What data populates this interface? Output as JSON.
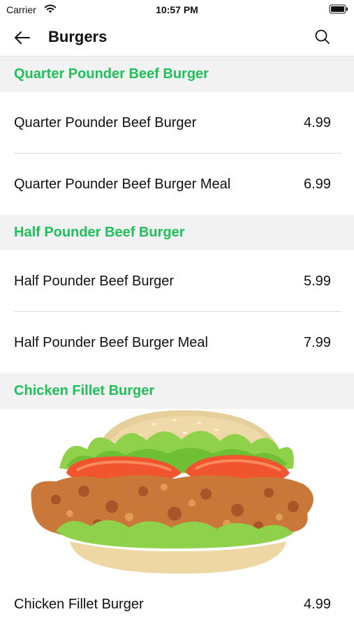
{
  "status_bar": {
    "carrier": "Carrier",
    "time": "10:57 PM"
  },
  "nav": {
    "title": "Burgers",
    "back_icon": "arrow-left-icon",
    "search_icon": "search-icon"
  },
  "sections": [
    {
      "title": "Quarter Pounder Beef Burger",
      "items": [
        {
          "name": "Quarter Pounder Beef Burger",
          "price": "4.99"
        },
        {
          "name": "Quarter Pounder Beef Burger Meal",
          "price": "6.99"
        }
      ]
    },
    {
      "title": "Half Pounder Beef Burger",
      "items": [
        {
          "name": "Half Pounder Beef Burger",
          "price": "5.99"
        },
        {
          "name": "Half Pounder Beef Burger Meal",
          "price": "7.99"
        }
      ]
    },
    {
      "title": "Chicken Fillet Burger",
      "items": [
        {
          "name": "Chicken Fillet Burger",
          "price": "4.99"
        }
      ]
    }
  ],
  "colors": {
    "accent": "#1ec05a",
    "section_background": "#f2f2f2"
  }
}
